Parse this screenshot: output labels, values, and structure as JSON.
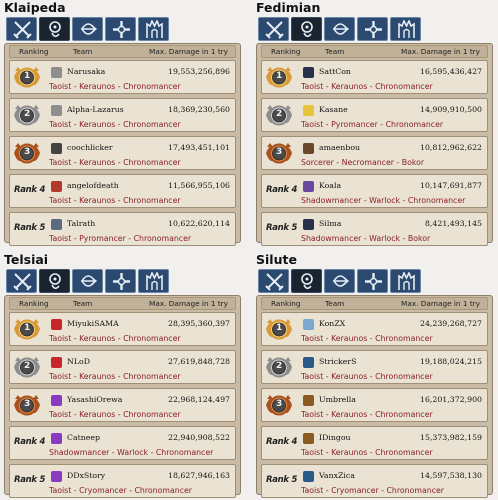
{
  "header": {
    "ranking": "Ranking",
    "team": "Team",
    "damage": "Max. Damage in 1 try"
  },
  "tabs": [
    {
      "icon": "crossed-swords-icon"
    },
    {
      "icon": "wizard-icon"
    },
    {
      "icon": "bow-icon"
    },
    {
      "icon": "cross-icon"
    },
    {
      "icon": "castle-gate-icon"
    }
  ],
  "colors": {
    "tab": "#2c4a6f",
    "tab_selected": "#1a2430",
    "team_text": "#8a1f2a",
    "gold": "#d99a3a",
    "silver": "#b8b8b8",
    "bronze": "#c2642c"
  },
  "panels": [
    {
      "title": "Klaipeda",
      "rows": [
        {
          "rank": "1",
          "name": "Narusaka",
          "damage": "19,553,256,896",
          "team": "Taoist - Keraunos - Chronomancer",
          "icon": "gray-skull-icon"
        },
        {
          "rank": "2",
          "name": "Alpha-Lazarus",
          "damage": "18,369,230,560",
          "team": "Taoist - Keraunos - Chronomancer",
          "icon": "gray-skull-icon"
        },
        {
          "rank": "3",
          "name": "coochlicker",
          "damage": "17,493,451,101",
          "team": "Taoist - Keraunos - Chronomancer",
          "icon": "sunglasses-icon"
        },
        {
          "rank": "Rank 4",
          "name": "angelofdeath",
          "damage": "11,566,955,106",
          "team": "Taoist - Keraunos - Chronomancer",
          "icon": "red-banner-icon"
        },
        {
          "rank": "Rank 5",
          "name": "Talrath",
          "damage": "10,622,620,114",
          "team": "Taoist - Pyromancer - Chronomancer",
          "icon": "trophy-icon"
        }
      ]
    },
    {
      "title": "Fedimian",
      "rows": [
        {
          "rank": "1",
          "name": "SattCon",
          "damage": "16,595,436,427",
          "team": "Taoist - Keraunos - Chronomancer",
          "icon": "moon-icon"
        },
        {
          "rank": "2",
          "name": "Kasane",
          "damage": "14,909,910,500",
          "team": "Taoist - Pyromancer - Chronomancer",
          "icon": "chick-icon"
        },
        {
          "rank": "3",
          "name": "amaenbou",
          "damage": "10,812,962,622",
          "team": "Sorcerer - Necromancer - Bokor",
          "icon": "cat-icon"
        },
        {
          "rank": "Rank 4",
          "name": "Koala",
          "damage": "10,147,691,877",
          "team": "Shadowmancer - Warlock - Chronomancer",
          "icon": "sword-icon"
        },
        {
          "rank": "Rank 5",
          "name": "Silma",
          "damage": "8,421,493,145",
          "team": "Shadowmancer - Warlock - Bokor",
          "icon": "moon-icon"
        }
      ]
    },
    {
      "title": "Telsiai",
      "rows": [
        {
          "rank": "1",
          "name": "MiyukiSAMA",
          "damage": "28,395,360,397",
          "team": "Taoist - Keraunos - Chronomancer",
          "icon": "red-bird-icon"
        },
        {
          "rank": "2",
          "name": "NLoD",
          "damage": "27,619,848,728",
          "team": "Taoist - Keraunos - Chronomancer",
          "icon": "red-bird-icon"
        },
        {
          "rank": "3",
          "name": "YasashiOrewa",
          "damage": "22,968,124,497",
          "team": "Taoist - Keraunos - Chronomancer",
          "icon": "purple-figure-icon"
        },
        {
          "rank": "Rank 4",
          "name": "Catneep",
          "damage": "22,940,908,522",
          "team": "Shadowmancer - Warlock - Chronomancer",
          "icon": "purple-figure-icon"
        },
        {
          "rank": "Rank 5",
          "name": "DDxStory",
          "damage": "18,627,946,163",
          "team": "Taoist - Cryomancer - Chronomancer",
          "icon": "purple-figure-icon"
        }
      ]
    },
    {
      "title": "Silute",
      "rows": [
        {
          "rank": "1",
          "name": "KonZX",
          "damage": "24,239,268,727",
          "team": "Taoist - Keraunos - Chronomancer",
          "icon": "snowflake-icon"
        },
        {
          "rank": "2",
          "name": "StrickerS",
          "damage": "19,188,024,215",
          "team": "Taoist - Keraunos - Chronomancer",
          "icon": "blue-shield-icon"
        },
        {
          "rank": "3",
          "name": "Umbrella",
          "damage": "16,201,372,900",
          "team": "Taoist - Keraunos - Chronomancer",
          "icon": "horn-icon"
        },
        {
          "rank": "Rank 4",
          "name": "IDingou",
          "damage": "15,373,982,159",
          "team": "Taoist - Keraunos - Chronomancer",
          "icon": "horn-icon"
        },
        {
          "rank": "Rank 5",
          "name": "VanxZica",
          "damage": "14,597,538,130",
          "team": "Taoist - Cryomancer - Chronomancer",
          "icon": "blue-shield-icon"
        }
      ]
    }
  ]
}
